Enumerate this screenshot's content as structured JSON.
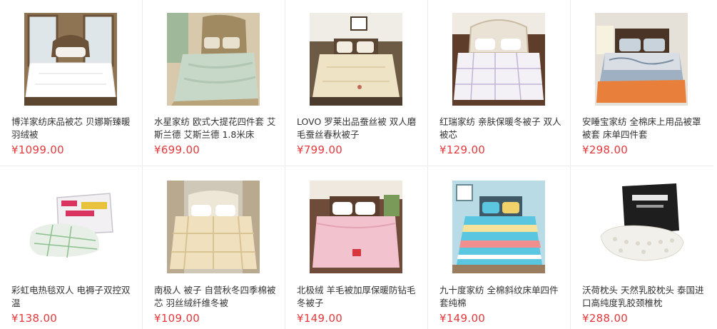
{
  "products": [
    {
      "title": "博洋家纺床品被芯 贝娜斯臻暖羽绒被",
      "price": "¥1099.00",
      "image": "white-duvet-bedroom",
      "colors": {
        "bed": "#ffffff",
        "bg": "#a88a63",
        "accent": "#6b5238"
      }
    },
    {
      "title": "水星家纺 欧式大提花四件套 艾斯兰德 艾斯兰德 1.8米床",
      "price": "¥699.00",
      "image": "mint-jacquard-bedding-set",
      "colors": {
        "bed": "#c7d8c9",
        "bg": "#d8c9ad",
        "accent": "#8a7a58"
      }
    },
    {
      "title": "LOVO 罗莱出品蚕丝被 双人磨毛蚕丝春秋被子",
      "price": "¥799.00",
      "image": "cream-silk-quilt",
      "colors": {
        "bed": "#efe3c6",
        "bg": "#6d5a44",
        "accent": "#c9b68c"
      }
    },
    {
      "title": "红瑞家纺 亲肤保暖冬被子 双人被芯",
      "price": "¥129.00",
      "image": "white-checked-quilt",
      "colors": {
        "bed": "#f3f1f6",
        "bg": "#5e3d2a",
        "accent": "#b7a4c8"
      }
    },
    {
      "title": "安睡宝家纺 全棉床上用品被罩被套 床单四件套",
      "price": "¥298.00",
      "image": "orange-paisley-bedding-set",
      "colors": {
        "bed": "#e8803c",
        "bg": "#e5e1d8",
        "accent": "#8fa2b6"
      }
    },
    {
      "title": "彩虹电热毯双人 电褥子双控双温",
      "price": "¥138.00",
      "image": "electric-blanket-box",
      "colors": {
        "bed": "#e7efe6",
        "bg": "#ffffff",
        "accent": "#d9345f"
      }
    },
    {
      "title": "南极人 被子 自营秋冬四季棉被芯 羽丝绒纤维冬被",
      "price": "¥109.00",
      "image": "beige-winter-quilt",
      "colors": {
        "bed": "#f1e0be",
        "bg": "#cfc7b8",
        "accent": "#a88d5c"
      }
    },
    {
      "title": "北极绒 羊毛被加厚保暖防钻毛冬被子",
      "price": "¥149.00",
      "image": "pink-wool-quilt",
      "colors": {
        "bed": "#f2c3cf",
        "bg": "#6f4c3a",
        "accent": "#c98d9b"
      }
    },
    {
      "title": "九十度家纺 全棉斜纹床单四件套纯棉",
      "price": "¥149.00",
      "image": "striped-bedding-set",
      "colors": {
        "bed": "#5bc6e0",
        "bg": "#b9dbe6",
        "accent": "#f1d16a"
      }
    },
    {
      "title": "沃荷枕头 天然乳胶枕头 泰国进口高纯度乳胶颈椎枕",
      "price": "¥288.00",
      "image": "latex-pillow-box",
      "colors": {
        "bed": "#f2f0ea",
        "bg": "#ffffff",
        "accent": "#1e1e1e"
      }
    }
  ]
}
